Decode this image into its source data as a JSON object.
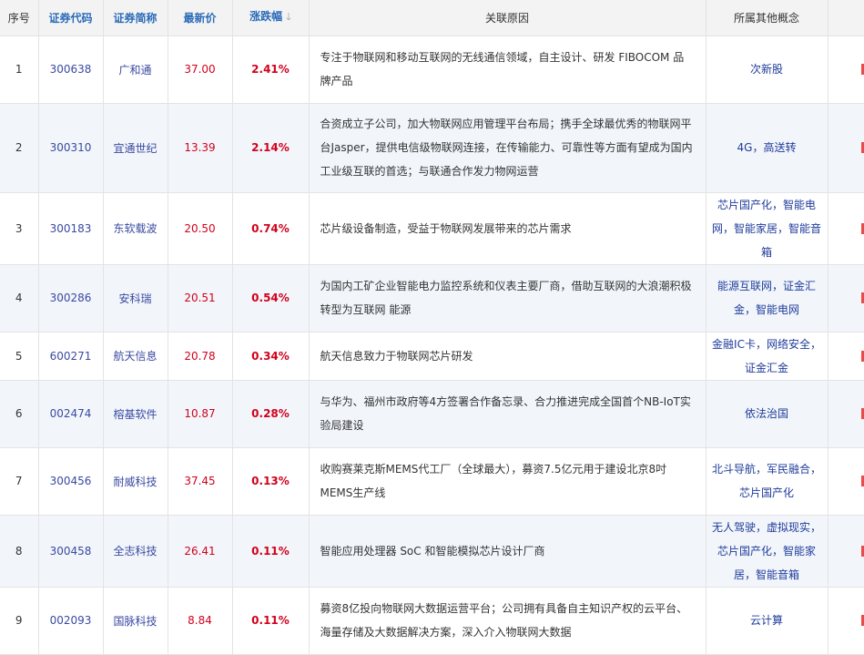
{
  "headers": {
    "seq": "序号",
    "code": "证券代码",
    "name": "证券简称",
    "price": "最新价",
    "change": "涨跌幅",
    "sort_icon": "arrow-down-icon",
    "reason": "关联原因",
    "concept": "所属其他概念"
  },
  "rows": [
    {
      "seq": "1",
      "code": "300638",
      "name": "广和通",
      "price": "37.00",
      "change": "2.41%",
      "reason": "专注于物联网和移动互联网的无线通信领域，自主设计、研发 FIBOCOM 品牌产品",
      "concept": "次新股"
    },
    {
      "seq": "2",
      "code": "300310",
      "name": "宜通世纪",
      "price": "13.39",
      "change": "2.14%",
      "reason": "合资成立子公司，加大物联网应用管理平台布局；携手全球最优秀的物联网平台Jasper，提供电信级物联网连接，在传输能力、可靠性等方面有望成为国内工业级互联的首选；与联通合作发力物网运营",
      "concept": "4G，高送转"
    },
    {
      "seq": "3",
      "code": "300183",
      "name": "东软载波",
      "price": "20.50",
      "change": "0.74%",
      "reason": "芯片级设备制造，受益于物联网发展带来的芯片需求",
      "concept": "芯片国产化，智能电网，智能家居，智能音箱"
    },
    {
      "seq": "4",
      "code": "300286",
      "name": "安科瑞",
      "price": "20.51",
      "change": "0.54%",
      "reason": "为国内工矿企业智能电力监控系统和仪表主要厂商，借助互联网的大浪潮积极转型为互联网 能源",
      "concept": "能源互联网，证金汇金，智能电网"
    },
    {
      "seq": "5",
      "code": "600271",
      "name": "航天信息",
      "price": "20.78",
      "change": "0.34%",
      "reason": "航天信息致力于物联网芯片研发",
      "concept": "金融IC卡，网络安全，证金汇金"
    },
    {
      "seq": "6",
      "code": "002474",
      "name": "榕基软件",
      "price": "10.87",
      "change": "0.28%",
      "reason": "与华为、福州市政府等4方签署合作备忘录、合力推进完成全国首个NB-IoT实验局建设",
      "concept": "依法治国"
    },
    {
      "seq": "7",
      "code": "300456",
      "name": "耐威科技",
      "price": "37.45",
      "change": "0.13%",
      "reason": "收购赛莱克斯MEMS代工厂（全球最大），募资7.5亿元用于建设北京8吋MEMS生产线",
      "concept": "北斗导航，军民融合，芯片国产化"
    },
    {
      "seq": "8",
      "code": "300458",
      "name": "全志科技",
      "price": "26.41",
      "change": "0.11%",
      "reason": "智能应用处理器 SoC 和智能模拟芯片设计厂商",
      "concept": "无人驾驶，虚拟现实，芯片国产化，智能家居，智能音箱"
    },
    {
      "seq": "9",
      "code": "002093",
      "name": "国脉科技",
      "price": "8.84",
      "change": "0.11%",
      "reason": "募资8亿投向物联网大数据运营平台；公司拥有具备自主知识产权的云平台、海量存储及大数据解决方案，深入介入物联网大数据",
      "concept": "云计算"
    }
  ],
  "colors": {
    "header_blue": "#2b6bb8",
    "link_blue": "#3a4aa0",
    "up_red": "#d0021b",
    "row_alt": "#f2f6fb",
    "header_bg": "#f3f3f3"
  }
}
